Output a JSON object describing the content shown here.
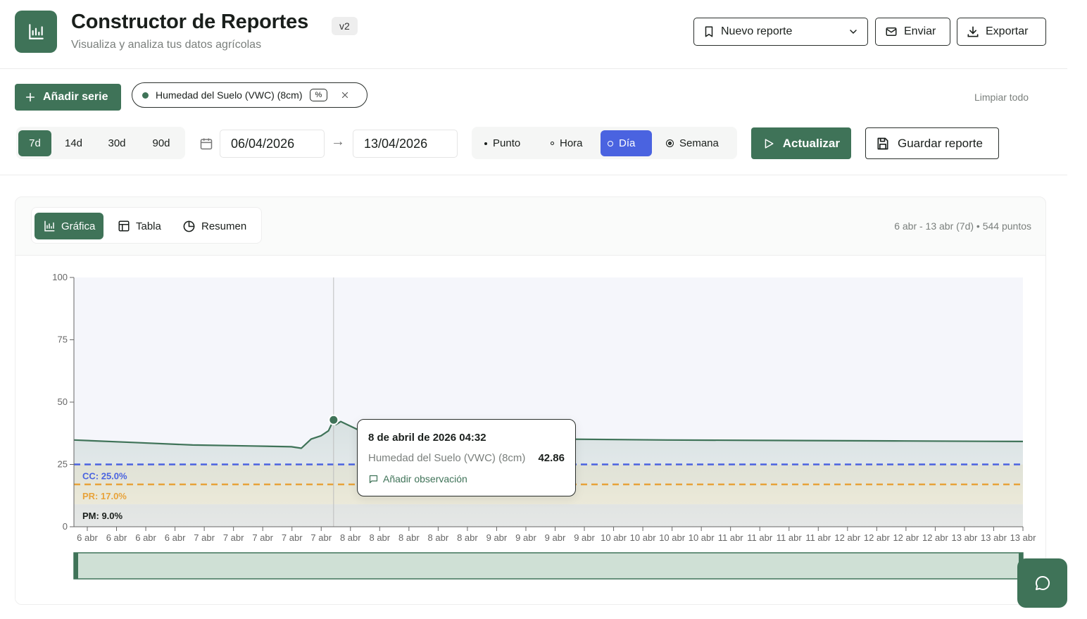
{
  "header": {
    "title": "Constructor de Reportes",
    "version": "v2",
    "subtitle": "Visualiza y analiza tus datos agrícolas",
    "report_select": "Nuevo reporte",
    "send_label": "Enviar",
    "export_label": "Exportar"
  },
  "toolbar": {
    "add_series_label": "Añadir serie",
    "series_chip": {
      "label": "Humedad del Suelo (VWC) (8cm)",
      "unit": "%"
    },
    "clear_all_label": "Limpiar todo",
    "ranges": [
      "7d",
      "14d",
      "30d",
      "90d"
    ],
    "active_range": "7d",
    "date_from": "06/04/2026",
    "date_to": "13/04/2026",
    "granularity": [
      "Punto",
      "Hora",
      "Día",
      "Semana"
    ],
    "active_granularity": "Día",
    "refresh_label": "Actualizar",
    "save_label": "Guardar reporte"
  },
  "card": {
    "tabs": [
      "Gráfica",
      "Tabla",
      "Resumen"
    ],
    "active_tab": "Gráfica",
    "range_info": "6 abr - 13 abr (7d) • 544 puntos"
  },
  "tooltip": {
    "date": "8 de abril de 2026 04:32",
    "series": "Humedad del Suelo (VWC) (8cm)",
    "value": "42.86",
    "add_observation_label": "Añadir observación"
  },
  "chart_data": {
    "type": "line",
    "y_ticks": [
      "0",
      "25",
      "50",
      "75",
      "100"
    ],
    "ylim": [
      0,
      100
    ],
    "x_tick_labels": [
      "6 abr",
      "6 abr",
      "6 abr",
      "6 abr",
      "7 abr",
      "7 abr",
      "7 abr",
      "7 abr",
      "7 abr",
      "8 abr",
      "8 abr",
      "8 abr",
      "8 abr",
      "8 abr",
      "9 abr",
      "9 abr",
      "9 abr",
      "9 abr",
      "10 abr",
      "10 abr",
      "10 abr",
      "10 abr",
      "11 abr",
      "11 abr",
      "11 abr",
      "11 abr",
      "12 abr",
      "12 abr",
      "12 abr",
      "12 abr",
      "13 abr",
      "13 abr",
      "13 abr"
    ],
    "series": [
      {
        "name": "Humedad del Suelo (VWC) (8cm)",
        "color": "#3f7358",
        "x": [
          "6 abr 00:00",
          "6 abr 12:00",
          "7 abr 00:00",
          "7 abr 12:00",
          "7 abr 20:00",
          "7 abr 22:00",
          "8 abr 00:00",
          "8 abr 02:00",
          "8 abr 03:30",
          "8 abr 04:32",
          "8 abr 05:00",
          "8 abr 06:00",
          "8 abr 12:00",
          "9 abr 00:00",
          "10 abr 00:00",
          "11 abr 00:00",
          "12 abr 00:00",
          "13 abr 00:00",
          "13 abr 24:00"
        ],
        "values": [
          34.8,
          33.8,
          32.8,
          32.4,
          32.1,
          31.5,
          35.2,
          36.5,
          38.5,
          42.86,
          41.0,
          42.2,
          36.5,
          35.5,
          35.2,
          34.8,
          34.6,
          34.4,
          34.2
        ]
      }
    ],
    "thresholds": [
      {
        "label": "CC: 25.0%",
        "value": 25.0,
        "color": "#4a63e0"
      },
      {
        "label": "PR: 17.0%",
        "value": 17.0,
        "color": "#e8a33a"
      },
      {
        "label": "PM: 9.0%",
        "value": 9.0,
        "color": "#1a1f1c"
      }
    ],
    "cursor_x": "8 abr 04:32"
  }
}
